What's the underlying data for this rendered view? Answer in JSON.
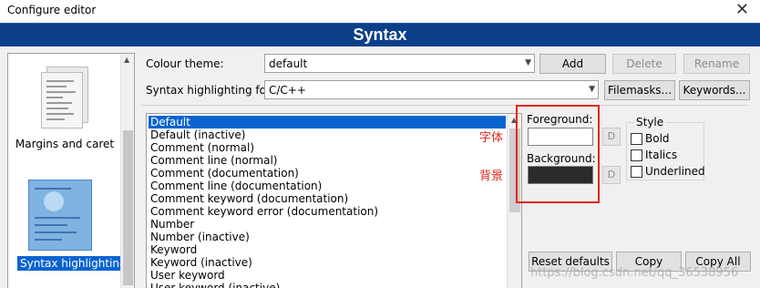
{
  "window": {
    "title": "Configure editor",
    "close_glyph": "✕"
  },
  "header": {
    "title": "Syntax"
  },
  "nav": {
    "items": [
      {
        "label": "Margins and caret",
        "icon": "document-pages-icon"
      },
      {
        "label": "Syntax highlighting",
        "icon": "syntax-document-icon",
        "selected": true
      }
    ]
  },
  "colour_theme": {
    "label": "Colour theme:",
    "value": "default"
  },
  "buttons": {
    "add": "Add",
    "delete": "Delete",
    "rename": "Rename",
    "filemasks": "Filemasks...",
    "keywords": "Keywords...",
    "reset_defaults": "Reset defaults",
    "copy": "Copy",
    "copy_all": "Copy All"
  },
  "syntax": {
    "label": "Syntax highlighting for:",
    "value": "C/C++"
  },
  "styles_list": [
    "Default",
    "Default (inactive)",
    "Comment (normal)",
    "Comment line (normal)",
    "Comment (documentation)",
    "Comment line (documentation)",
    "Comment keyword (documentation)",
    "Comment keyword error (documentation)",
    "Number",
    "Number (inactive)",
    "Keyword",
    "Keyword (inactive)",
    "User keyword",
    "User keyword (inactive)"
  ],
  "selected_style_index": 0,
  "colours": {
    "foreground_label": "Foreground:",
    "background_label": "Background:",
    "foreground_value": "#ffffff",
    "background_value": "#2b2b2b",
    "default_button": "D"
  },
  "style_group": {
    "title": "Style",
    "bold": "Bold",
    "italics": "Italics",
    "underlined": "Underlined"
  },
  "annotations": {
    "font": "字体",
    "background": "背景",
    "color": "#e0261b"
  },
  "watermark": "https://blog.csdn.net/qq_36538956"
}
